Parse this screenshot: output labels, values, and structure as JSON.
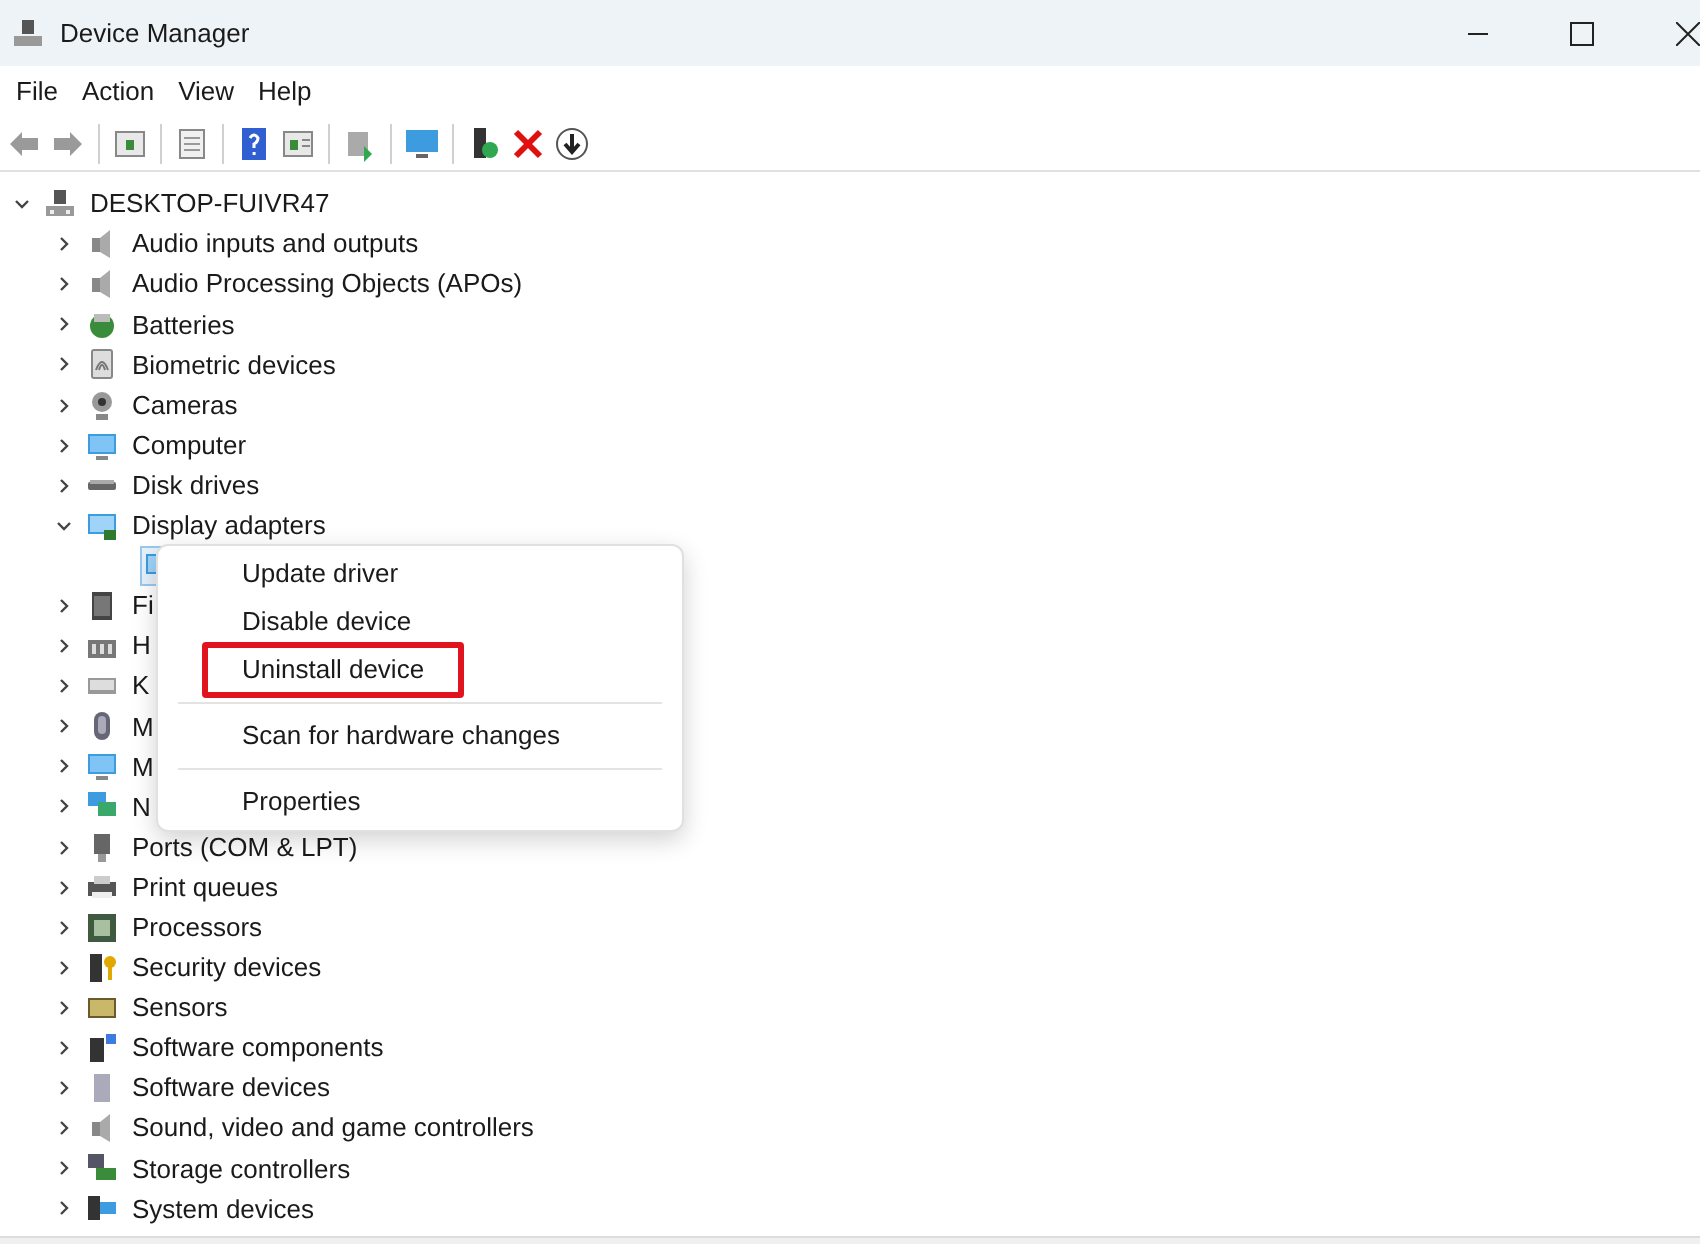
{
  "window": {
    "title": "Device Manager"
  },
  "menu_bar": [
    "File",
    "Action",
    "View",
    "Help"
  ],
  "tree": {
    "label": "DESKTOP-FUIVR47",
    "kind": "computer",
    "expanded": true,
    "children": [
      {
        "label": "Audio inputs and outputs",
        "kind": "speaker",
        "expanded": false
      },
      {
        "label": "Audio Processing Objects (APOs)",
        "kind": "speaker",
        "expanded": false
      },
      {
        "label": "Batteries",
        "kind": "battery",
        "expanded": false
      },
      {
        "label": "Biometric devices",
        "kind": "fingerprint",
        "expanded": false
      },
      {
        "label": "Cameras",
        "kind": "camera",
        "expanded": false
      },
      {
        "label": "Computer",
        "kind": "monitor",
        "expanded": false
      },
      {
        "label": "Disk drives",
        "kind": "disk",
        "expanded": false
      },
      {
        "label": "Display adapters",
        "kind": "display",
        "expanded": true,
        "children": [
          {
            "kind": "display"
          }
        ]
      },
      {
        "label": "Fi",
        "kind": "firmware",
        "expanded": false
      },
      {
        "label": "H",
        "kind": "hid",
        "expanded": false
      },
      {
        "label": "K",
        "kind": "keyboard",
        "expanded": false
      },
      {
        "label": "M",
        "kind": "mouse",
        "expanded": false
      },
      {
        "label": "M",
        "kind": "monitor",
        "expanded": false
      },
      {
        "label": "N",
        "kind": "network",
        "expanded": false
      },
      {
        "label": "Ports (COM & LPT)",
        "kind": "port",
        "expanded": false
      },
      {
        "label": "Print queues",
        "kind": "printer",
        "expanded": false
      },
      {
        "label": "Processors",
        "kind": "chip",
        "expanded": false
      },
      {
        "label": "Security devices",
        "kind": "security",
        "expanded": false
      },
      {
        "label": "Sensors",
        "kind": "sensor",
        "expanded": false
      },
      {
        "label": "Software components",
        "kind": "component",
        "expanded": false
      },
      {
        "label": "Software devices",
        "kind": "software",
        "expanded": false
      },
      {
        "label": "Sound, video and game controllers",
        "kind": "speaker",
        "expanded": false
      },
      {
        "label": "Storage controllers",
        "kind": "storage",
        "expanded": false
      },
      {
        "label": "System devices",
        "kind": "system",
        "expanded": false
      }
    ]
  },
  "context_menu": {
    "items": [
      {
        "label": "Update driver",
        "highlighted": false
      },
      {
        "label": "Disable device",
        "highlighted": false
      },
      {
        "label": "Uninstall device",
        "highlighted": true
      },
      {
        "kind": "separator"
      },
      {
        "label": "Scan for hardware changes",
        "highlighted": false
      },
      {
        "kind": "separator"
      },
      {
        "label": "Properties",
        "highlighted": false
      }
    ]
  }
}
